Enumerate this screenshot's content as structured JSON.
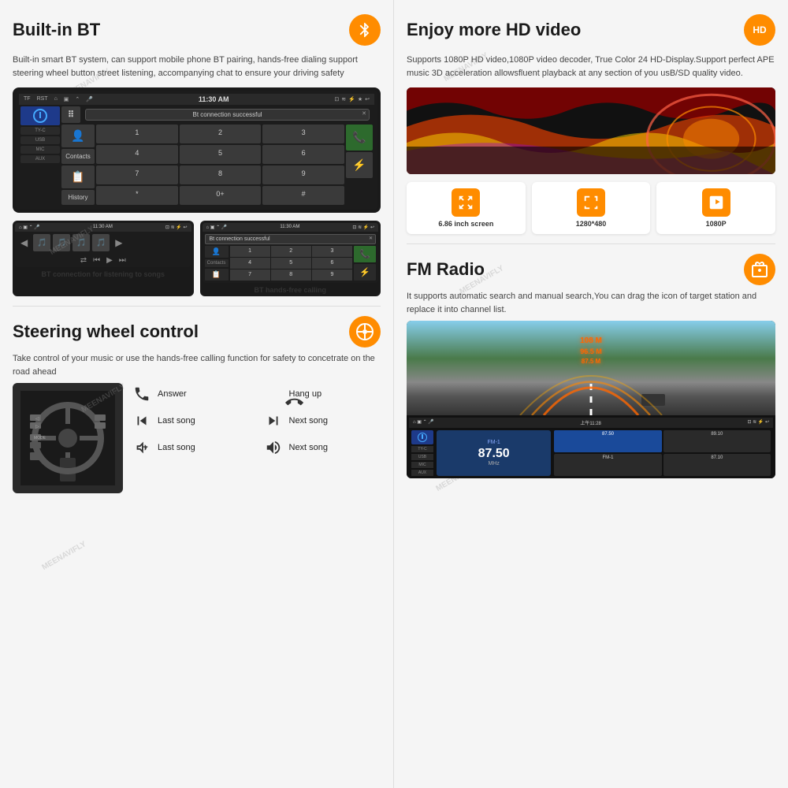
{
  "left": {
    "bt_section": {
      "title": "Built-in BT",
      "icon": "bluetooth",
      "description": "Built-in smart BT system, can support mobile phone BT pairing, hands-free dialing support steering wheel button street listening, accompanying chat to ensure your driving safety",
      "screen": {
        "time": "11:30 AM",
        "notification": "Bt connection successful",
        "dialpad_keys": [
          "1",
          "2",
          "3",
          "4",
          "5",
          "6",
          "7",
          "8",
          "9",
          "*",
          "0+",
          "#"
        ]
      },
      "bt_listen_caption": "BT connection for listening to songs",
      "bt_call_caption": "BT hands-free calling"
    },
    "steering_section": {
      "title": "Steering wheel control",
      "description": "Take control of your music or use the hands-free calling function for safety to concetrate on the road ahead",
      "controls": [
        {
          "icon": "phone",
          "label": "Answer"
        },
        {
          "icon": "phone-end",
          "label": "Hang up"
        },
        {
          "icon": "skip-back",
          "label": "Last song"
        },
        {
          "icon": "skip-forward",
          "label": "Next song"
        },
        {
          "icon": "volume-down",
          "label": "Last song"
        },
        {
          "icon": "volume-up",
          "label": "Next song"
        }
      ]
    }
  },
  "right": {
    "hd_section": {
      "title": "Enjoy more HD video",
      "badge": "HD",
      "description": "Supports 1080P HD video,1080P video decoder, True Color 24 HD-Display.Support perfect APE music 3D acceleration allowsfluent playback at any section of you usB/SD quality video."
    },
    "specs": [
      {
        "icon": "expand",
        "label": "6.86 inch screen"
      },
      {
        "icon": "fullscreen",
        "label": "1280*480"
      },
      {
        "icon": "play-box",
        "label": "1080P"
      }
    ],
    "fm_section": {
      "title": "FM Radio",
      "description": "It supports automatic search and manual search,You can drag the icon of target station and replace it into channel list.",
      "frequencies": [
        "108 M",
        "96.5 M",
        "87.5 M"
      ],
      "current_freq": "87.50",
      "freq_unit": "MHz",
      "time": "上午11:28",
      "presets": [
        "87.50",
        "89.10",
        "FM-1",
        "87.10"
      ]
    }
  }
}
